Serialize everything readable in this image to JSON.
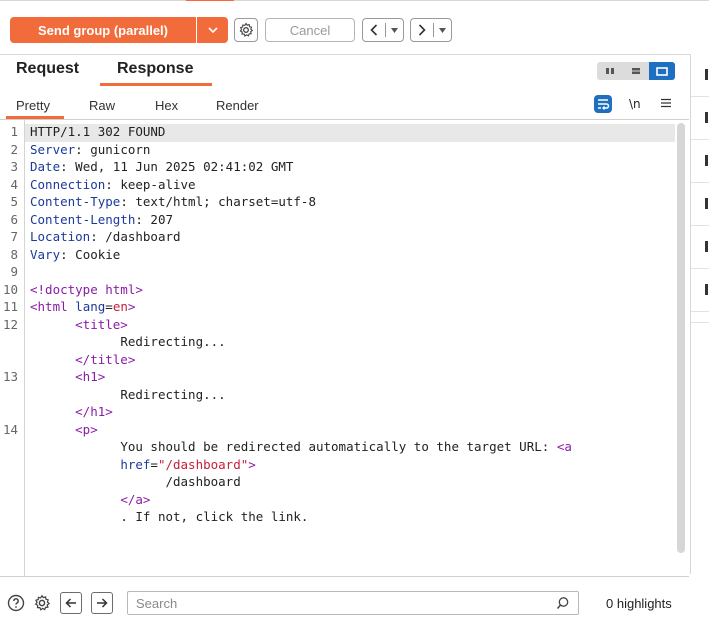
{
  "toolbar": {
    "send_label": "Send group (parallel)",
    "cancel_label": "Cancel",
    "accent": "#f26b3a"
  },
  "tabs": {
    "request": "Request",
    "response": "Response"
  },
  "subtabs": {
    "pretty": "Pretty",
    "raw": "Raw",
    "hex": "Hex",
    "render": "Render",
    "newline": "\\n"
  },
  "editor": {
    "line_numbers": [
      "1",
      "2",
      "3",
      "4",
      "5",
      "6",
      "7",
      "8",
      "9",
      "10",
      "11",
      "12",
      "13",
      "14"
    ],
    "headers": [
      {
        "key": "HTTP/1.1 302 FOUND",
        "value": ""
      },
      {
        "key": "Server",
        "value": " gunicorn"
      },
      {
        "key": "Date",
        "value": " Wed, 11 Jun 2025 02:41:02 GMT"
      },
      {
        "key": "Connection",
        "value": " keep-alive"
      },
      {
        "key": "Content-Type",
        "value": " text/html; charset=utf-8"
      },
      {
        "key": "Content-Length",
        "value": " 207"
      },
      {
        "key": "Location",
        "value": " /dashboard"
      },
      {
        "key": "Vary",
        "value": " Cookie"
      }
    ],
    "doctype": "<!doctype html>",
    "html_open": "<html",
    "lang_attr": "lang",
    "lang_val": "en",
    "title_open": "<title>",
    "title_text": "Redirecting...",
    "title_close": "</title>",
    "h1_open": "<h1>",
    "h1_text": "Redirecting...",
    "h1_close": "</h1>",
    "p_open": "<p>",
    "p_text": "You should be redirected automatically to the target URL: ",
    "a_open": "<a",
    "href_attr": "href",
    "href_val": "\"/dashboard\"",
    "a_gt": ">",
    "a_text": "/dashboard",
    "a_close": "</a>",
    "tail_text": ". If not, click the link."
  },
  "bottom": {
    "search_placeholder": "Search",
    "highlights": "0 highlights"
  }
}
